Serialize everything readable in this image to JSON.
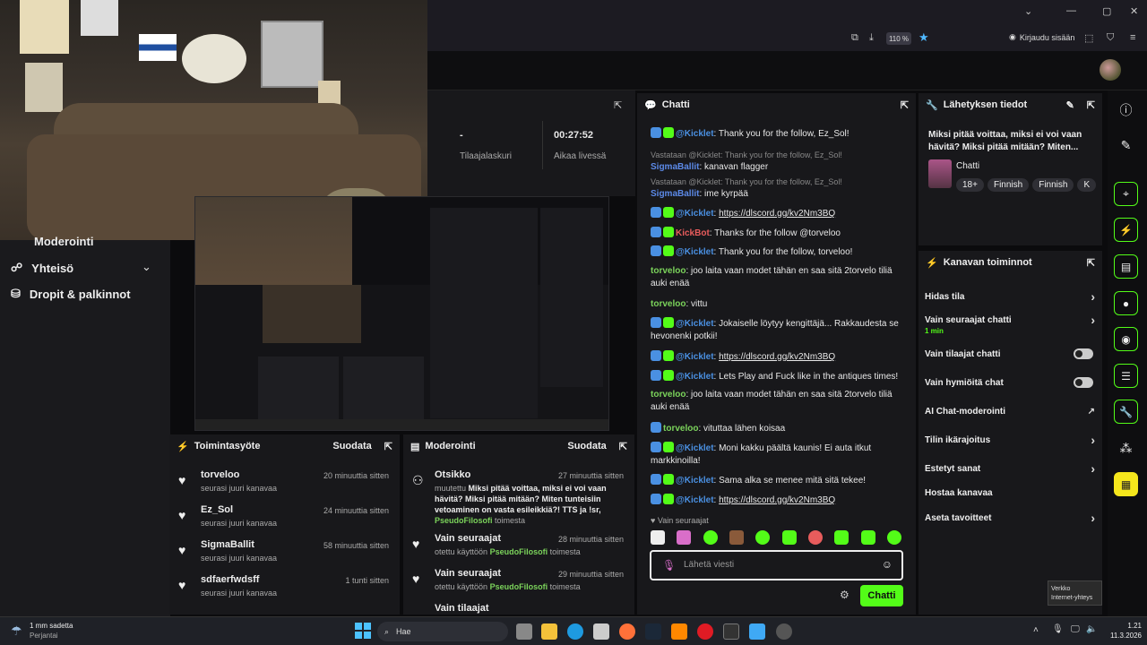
{
  "browser": {
    "zoom": "110 %",
    "signin": "Kirjaudu sisään"
  },
  "nav": {
    "items": [
      {
        "label": "Moderointi"
      },
      {
        "label": "Yhteisö"
      },
      {
        "label": "Dropit & palkinnot"
      }
    ]
  },
  "stats": {
    "subs_value": "-",
    "subs_label": "Tilaajalaskuri",
    "uptime_value": "00:27:52",
    "uptime_label": "Aikaa livessä"
  },
  "activity": {
    "title": "Toimintasyöte",
    "filter": "Suodata",
    "items": [
      {
        "name": "torveloo",
        "sub": "seurasi juuri kanavaa",
        "time": "20 minuuttia sitten"
      },
      {
        "name": "Ez_Sol",
        "sub": "seurasi juuri kanavaa",
        "time": "24 minuuttia sitten"
      },
      {
        "name": "SigmaBallit",
        "sub": "seurasi juuri kanavaa",
        "time": "58 minuuttia sitten"
      },
      {
        "name": "sdfaerfwdsff",
        "sub": "seurasi juuri kanavaa",
        "time": "1 tunti sitten"
      }
    ]
  },
  "moderation": {
    "title": "Moderointi",
    "filter": "Suodata",
    "items": [
      {
        "name": "Otsikko",
        "time": "27 minuuttia sitten",
        "prefix": "muutettu",
        "text": "Miksi pitää voittaa, miksi ei voi vaan hävitä? Miksi pitää mitään? Miten tunteisiin vetoaminen on vasta esileikkiä?! TTS ja !sr,",
        "by": "PseudoFilosofi",
        "suffix": "toimesta"
      },
      {
        "name": "Vain seuraajat",
        "time": "28 minuuttia sitten",
        "prefix": "otettu käyttöön",
        "by": "PseudoFilosofi",
        "suffix": "toimesta"
      },
      {
        "name": "Vain seuraajat",
        "time": "29 minuuttia sitten",
        "prefix": "otettu käyttöön",
        "by": "PseudoFilosofi",
        "suffix": "toimesta"
      },
      {
        "name": "Vain tilaajat"
      }
    ]
  },
  "chat": {
    "title": "Chatti",
    "followers_only": "Vain seuraajat",
    "placeholder": "Lähetä viesti",
    "send": "Chatti",
    "messages": {
      "m1_user": "@Kicklet",
      "m1_text": ": Thank you for the follow, Ez_Sol!",
      "m2_reply": "Vastataan @Kicklet: Thank you for the follow, Ez_Sol!",
      "m2_user": "SigmaBallit",
      "m2_text": ": kanavan flagger",
      "m3_reply": "Vastataan @Kicklet: Thank you for the follow, Ez_Sol!",
      "m3_user": "SigmaBallit",
      "m3_text": ": ime kyrpää",
      "m4_user": "@Kicklet",
      "m4_link": "https://dlscord.gg/kv2Nm3BQ",
      "m5_user": "KickBot",
      "m5_text": ": Thanks for the follow @torveloo",
      "m6_user": "@Kicklet",
      "m6_text": ": Thank you for the follow, torveloo!",
      "m7_user": "torveloo",
      "m7_text": ": joo laita vaan modet tähän en saa sitä 2torvelo tiliä auki enää",
      "m8_user": "torveloo",
      "m8_text": ": vittu",
      "m9_user": "@Kicklet",
      "m9_text": ": Jokaiselle löytyy kengittäjä... Rakkaudesta se hevonenki potkii!",
      "m10_user": "@Kicklet",
      "m10_link": "https://dlscord.gg/kv2Nm3BQ",
      "m11_user": "@Kicklet",
      "m11_text": ": Lets Play and Fuck like in the antiques times!",
      "m12_user": "torveloo",
      "m12_text": ": joo laita vaan modet tähän en saa sitä 2torvelo tiliä auki enää",
      "m13_user": "torveloo",
      "m13_text": ": vituttaa lähen koisaa",
      "m14_user": "@Kicklet",
      "m14_text": ": Moni kakku päältä kaunis! Ei auta itkut markkinoilla!",
      "m15_user": "@Kicklet",
      "m15_text": ": Sama alka se menee mitä sitä tekee!",
      "m16_user": "@Kicklet",
      "m16_link": "https://dlscord.gg/kv2Nm3BQ"
    }
  },
  "streaminfo": {
    "title": "Lähetyksen tiedot",
    "stream_title": "Miksi pitää voittaa, miksi ei voi vaan hävitä? Miksi pitää mitään? Miten...",
    "category": "Chatti",
    "tags": [
      "18+",
      "Finnish",
      "Finnish",
      "K"
    ]
  },
  "channel_actions": {
    "title": "Kanavan toiminnot",
    "items": [
      {
        "label": "Hidas tila",
        "sub": ""
      },
      {
        "label": "Vain seuraajat chatti",
        "sub": "1 min"
      },
      {
        "label": "Vain tilaajat chatti",
        "sub": ""
      },
      {
        "label": "Vain hymiöitä chat",
        "sub": ""
      },
      {
        "label": "AI Chat-moderointi",
        "sub": ""
      },
      {
        "label": "Tilin ikärajoitus",
        "sub": ""
      },
      {
        "label": "Estetyt sanat",
        "sub": ""
      },
      {
        "label": "Hostaa kanavaa",
        "sub": ""
      },
      {
        "label": "Aseta tavoitteet",
        "sub": ""
      }
    ]
  },
  "taskbar": {
    "weather": "1 mm sadetta",
    "day": "Perjantai",
    "search": "Hae",
    "time": "1.21",
    "date": "11.3.2026",
    "tooltip_title": "Verkko",
    "tooltip_sub": "Internet-yhteys"
  },
  "colors": {
    "accent": "#53fc18",
    "bg": "#0e0e10",
    "panel": "#18181b"
  }
}
